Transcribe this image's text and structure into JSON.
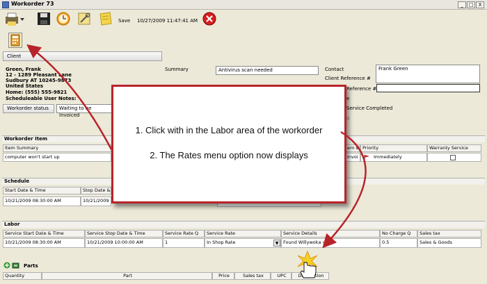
{
  "window": {
    "title": "Workorder 73",
    "min": "_",
    "max": "□",
    "close": "X"
  },
  "toolbar": {
    "save_label": "Save",
    "timestamp": "10/27/2009 11:47:41 AM"
  },
  "client": {
    "tab_label": "Client",
    "name": "Green, Frank",
    "address1": "12 - 1289 Pleasant Lane",
    "address2": "Sudbury AT 10245-9873",
    "country": "United States",
    "home": "Home: (555) 555-9821",
    "notes_label": "Scheduleable User Notes:"
  },
  "summary": {
    "label": "Summary",
    "value": "Antivirus scan needed"
  },
  "contact": {
    "contact_label": "Contact",
    "contact_value": "Frank Green",
    "client_ref_label": "Client Reference #",
    "ref_label_partial": "Reference #",
    "e_partial": "e",
    "service_completed": "Service Completed",
    "d_partial": "d"
  },
  "status": {
    "label": "Workorder status",
    "value": "Waiting to be Invoiced"
  },
  "workorder_item": {
    "section": "Workorder Item",
    "item_summary_label": "Item Summary",
    "item_summary_value": "computer won't start up",
    "status_col": "em sta",
    "status_val": "Invoi",
    "priority_col": "Priority",
    "priority_val": "Immediately",
    "warranty_col": "Warranty Service"
  },
  "schedule": {
    "section": "Schedule",
    "start_label": "Start Date & Time",
    "start_value": "10/21/2009 08:30:00 AM",
    "stop_label": "Stop Date &",
    "stop_value": "10/21/2009"
  },
  "labor": {
    "section": "Labor",
    "columns": [
      "Service Start Date & Time",
      "Service Stop Date & Time",
      "Service Rate Q",
      "Service Rate",
      "Service Details",
      "No Charge Q",
      "Sales tax"
    ],
    "row": [
      "10/21/2009 08:30:00 AM",
      "10/21/2009 10:00:00 AM",
      "1",
      "In Shop Rate",
      "Found Willywoka virus",
      "0.5",
      "Sales & Goods"
    ]
  },
  "parts": {
    "section": "Parts",
    "columns": [
      "Quantity",
      "Part",
      "Price",
      "Sales tax",
      "UPC",
      "Description"
    ]
  },
  "callout": {
    "line1": "1. Click with in the Labor area of the workorder",
    "line2": "2. The Rates menu option now displays"
  },
  "colors": {
    "accent_red": "#b8232a",
    "background": "#ece9d8"
  }
}
